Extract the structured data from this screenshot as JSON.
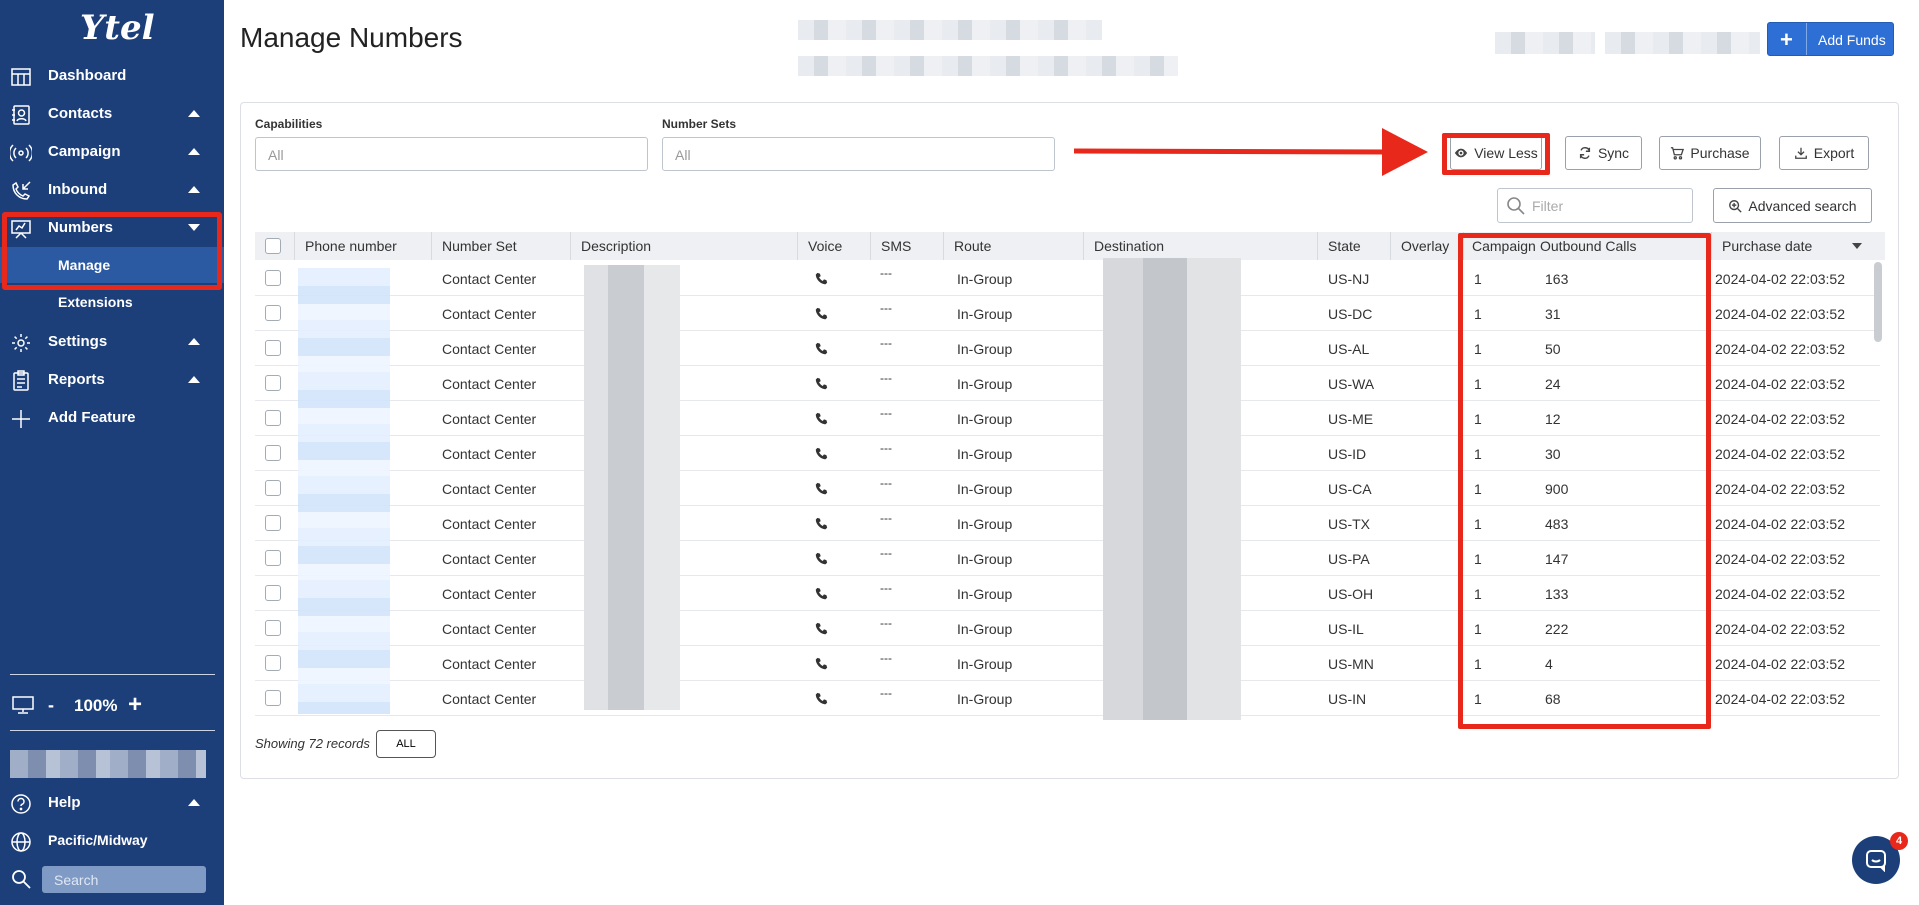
{
  "brand": {
    "logo_text": "Ytel"
  },
  "sidebar": {
    "items": [
      {
        "label": "Dashboard",
        "icon": "dashboard-icon",
        "caret": ""
      },
      {
        "label": "Contacts",
        "icon": "contacts-icon",
        "caret": "up"
      },
      {
        "label": "Campaign",
        "icon": "campaign-icon",
        "caret": "up"
      },
      {
        "label": "Inbound",
        "icon": "inbound-icon",
        "caret": "up"
      },
      {
        "label": "Numbers",
        "icon": "numbers-icon",
        "caret": "down"
      },
      {
        "label": "Settings",
        "icon": "settings-icon",
        "caret": "up"
      },
      {
        "label": "Reports",
        "icon": "reports-icon",
        "caret": "up"
      },
      {
        "label": "Add Feature",
        "icon": "plus-icon",
        "caret": ""
      }
    ],
    "sub_items": [
      {
        "label": "Manage",
        "active": true
      },
      {
        "label": "Extensions",
        "active": false
      }
    ],
    "zoom": {
      "minus": "-",
      "value": "100%",
      "plus": "+"
    },
    "help": "Help",
    "timezone": "Pacific/Midway",
    "search_placeholder": "Search"
  },
  "header": {
    "title": "Manage Numbers",
    "add_funds_icon": "+",
    "add_funds_label": "Add Funds"
  },
  "filters": {
    "capabilities_label": "Capabilities",
    "capabilities_value": "All",
    "number_sets_label": "Number Sets",
    "number_sets_value": "All",
    "filter_placeholder": "Filter"
  },
  "toolbar": {
    "view_less": "View Less",
    "sync": "Sync",
    "purchase": "Purchase",
    "export": "Export",
    "advanced_search": "Advanced search"
  },
  "table": {
    "columns": [
      "Phone number",
      "Number Set",
      "Description",
      "Voice",
      "SMS",
      "Route",
      "Destination",
      "State",
      "Overlay",
      "Campaigns",
      "Outbound Calls",
      "Purchase date"
    ],
    "rows": [
      {
        "number_set": "Contact Center",
        "sms": "---",
        "route": "In-Group",
        "state": "US-NJ",
        "campaigns": "1",
        "outbound": "163",
        "date": "2024-04-02 22:03:52"
      },
      {
        "number_set": "Contact Center",
        "sms": "---",
        "route": "In-Group",
        "state": "US-DC",
        "campaigns": "1",
        "outbound": "31",
        "date": "2024-04-02 22:03:52"
      },
      {
        "number_set": "Contact Center",
        "sms": "---",
        "route": "In-Group",
        "state": "US-AL",
        "campaigns": "1",
        "outbound": "50",
        "date": "2024-04-02 22:03:52"
      },
      {
        "number_set": "Contact Center",
        "sms": "---",
        "route": "In-Group",
        "state": "US-WA",
        "campaigns": "1",
        "outbound": "24",
        "date": "2024-04-02 22:03:52"
      },
      {
        "number_set": "Contact Center",
        "sms": "---",
        "route": "In-Group",
        "state": "US-ME",
        "campaigns": "1",
        "outbound": "12",
        "date": "2024-04-02 22:03:52"
      },
      {
        "number_set": "Contact Center",
        "sms": "---",
        "route": "In-Group",
        "state": "US-ID",
        "campaigns": "1",
        "outbound": "30",
        "date": "2024-04-02 22:03:52"
      },
      {
        "number_set": "Contact Center",
        "sms": "---",
        "route": "In-Group",
        "state": "US-CA",
        "campaigns": "1",
        "outbound": "900",
        "date": "2024-04-02 22:03:52"
      },
      {
        "number_set": "Contact Center",
        "sms": "---",
        "route": "In-Group",
        "state": "US-TX",
        "campaigns": "1",
        "outbound": "483",
        "date": "2024-04-02 22:03:52"
      },
      {
        "number_set": "Contact Center",
        "sms": "---",
        "route": "In-Group",
        "state": "US-PA",
        "campaigns": "1",
        "outbound": "147",
        "date": "2024-04-02 22:03:52"
      },
      {
        "number_set": "Contact Center",
        "sms": "---",
        "route": "In-Group",
        "state": "US-OH",
        "campaigns": "1",
        "outbound": "133",
        "date": "2024-04-02 22:03:52"
      },
      {
        "number_set": "Contact Center",
        "sms": "---",
        "route": "In-Group",
        "state": "US-IL",
        "campaigns": "1",
        "outbound": "222",
        "date": "2024-04-02 22:03:52"
      },
      {
        "number_set": "Contact Center",
        "sms": "---",
        "route": "In-Group",
        "state": "US-MN",
        "campaigns": "1",
        "outbound": "4",
        "date": "2024-04-02 22:03:52"
      },
      {
        "number_set": "Contact Center",
        "sms": "---",
        "route": "In-Group",
        "state": "US-IN",
        "campaigns": "1",
        "outbound": "68",
        "date": "2024-04-02 22:03:52"
      }
    ]
  },
  "footer": {
    "showing": "Showing 72 records",
    "all_button": "ALL"
  },
  "chat": {
    "badge": "4"
  },
  "colors": {
    "sidebar": "#1c3f7a",
    "accent": "#2e6fd6",
    "highlight": "#e8281b"
  }
}
